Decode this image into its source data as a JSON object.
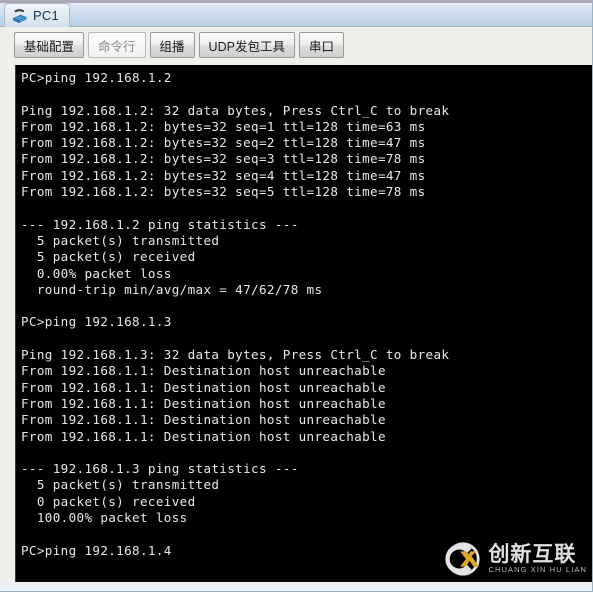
{
  "window": {
    "title": "PC1",
    "icon": "pc-device-icon"
  },
  "tabs": [
    {
      "label": "基础配置",
      "selected": false
    },
    {
      "label": "命令行",
      "selected": true
    },
    {
      "label": "组播",
      "selected": false
    },
    {
      "label": "UDP发包工具",
      "selected": false
    },
    {
      "label": "串口",
      "selected": false
    }
  ],
  "terminal": {
    "lines": [
      "PC>ping 192.168.1.2",
      "",
      "Ping 192.168.1.2: 32 data bytes, Press Ctrl_C to break",
      "From 192.168.1.2: bytes=32 seq=1 ttl=128 time=63 ms",
      "From 192.168.1.2: bytes=32 seq=2 ttl=128 time=47 ms",
      "From 192.168.1.2: bytes=32 seq=3 ttl=128 time=78 ms",
      "From 192.168.1.2: bytes=32 seq=4 ttl=128 time=47 ms",
      "From 192.168.1.2: bytes=32 seq=5 ttl=128 time=78 ms",
      "",
      "--- 192.168.1.2 ping statistics ---",
      "  5 packet(s) transmitted",
      "  5 packet(s) received",
      "  0.00% packet loss",
      "  round-trip min/avg/max = 47/62/78 ms",
      "",
      "PC>ping 192.168.1.3",
      "",
      "Ping 192.168.1.3: 32 data bytes, Press Ctrl_C to break",
      "From 192.168.1.1: Destination host unreachable",
      "From 192.168.1.1: Destination host unreachable",
      "From 192.168.1.1: Destination host unreachable",
      "From 192.168.1.1: Destination host unreachable",
      "From 192.168.1.1: Destination host unreachable",
      "",
      "--- 192.168.1.3 ping statistics ---",
      "  5 packet(s) transmitted",
      "  0 packet(s) received",
      "  100.00% packet loss",
      "",
      "PC>ping 192.168.1.4"
    ]
  },
  "watermark": {
    "chinese": "创新互联",
    "pinyin": "CHUANG XIN HU LIAN",
    "accent_color": "#f0b429"
  },
  "colors": {
    "terminal_background": "#000000",
    "terminal_text": "#e8e8e8",
    "titlebar_top": "#e6ecf4",
    "titlebar_bottom": "#b9d0e3",
    "panel_background": "#f0f0eb"
  }
}
